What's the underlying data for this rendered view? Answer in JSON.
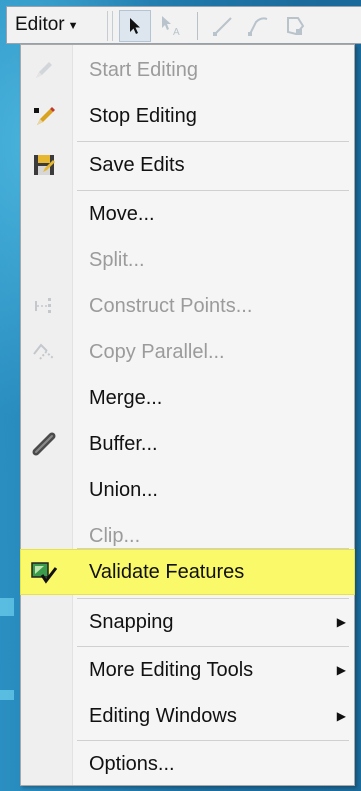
{
  "toolbar": {
    "editor_label": "Editor"
  },
  "menu": {
    "items": [
      {
        "label": "Start Editing",
        "disabled": true,
        "icon": "start-editing-icon"
      },
      {
        "label": "Stop Editing",
        "disabled": false,
        "icon": "stop-editing-icon"
      },
      {
        "label": "Save Edits",
        "disabled": false,
        "icon": "save-edits-icon"
      },
      {
        "label": "Move...",
        "disabled": false,
        "icon": ""
      },
      {
        "label": "Split...",
        "disabled": true,
        "icon": ""
      },
      {
        "label": "Construct Points...",
        "disabled": true,
        "icon": "construct-points-icon"
      },
      {
        "label": "Copy Parallel...",
        "disabled": true,
        "icon": "copy-parallel-icon"
      },
      {
        "label": "Merge...",
        "disabled": false,
        "icon": ""
      },
      {
        "label": "Buffer...",
        "disabled": false,
        "icon": "buffer-icon"
      },
      {
        "label": "Union...",
        "disabled": false,
        "icon": ""
      },
      {
        "label": "Clip...",
        "disabled": true,
        "icon": ""
      },
      {
        "label": "Validate Features",
        "disabled": false,
        "icon": "validate-features-icon",
        "highlighted": true
      },
      {
        "label": "Snapping",
        "disabled": false,
        "submenu": true
      },
      {
        "label": "More Editing Tools",
        "disabled": false,
        "submenu": true
      },
      {
        "label": "Editing Windows",
        "disabled": false,
        "submenu": true
      },
      {
        "label": "Options...",
        "disabled": false
      }
    ]
  },
  "colors": {
    "highlight": "#faf96a",
    "background": "#1d74a6",
    "disabled_text": "#9b9b9b"
  }
}
